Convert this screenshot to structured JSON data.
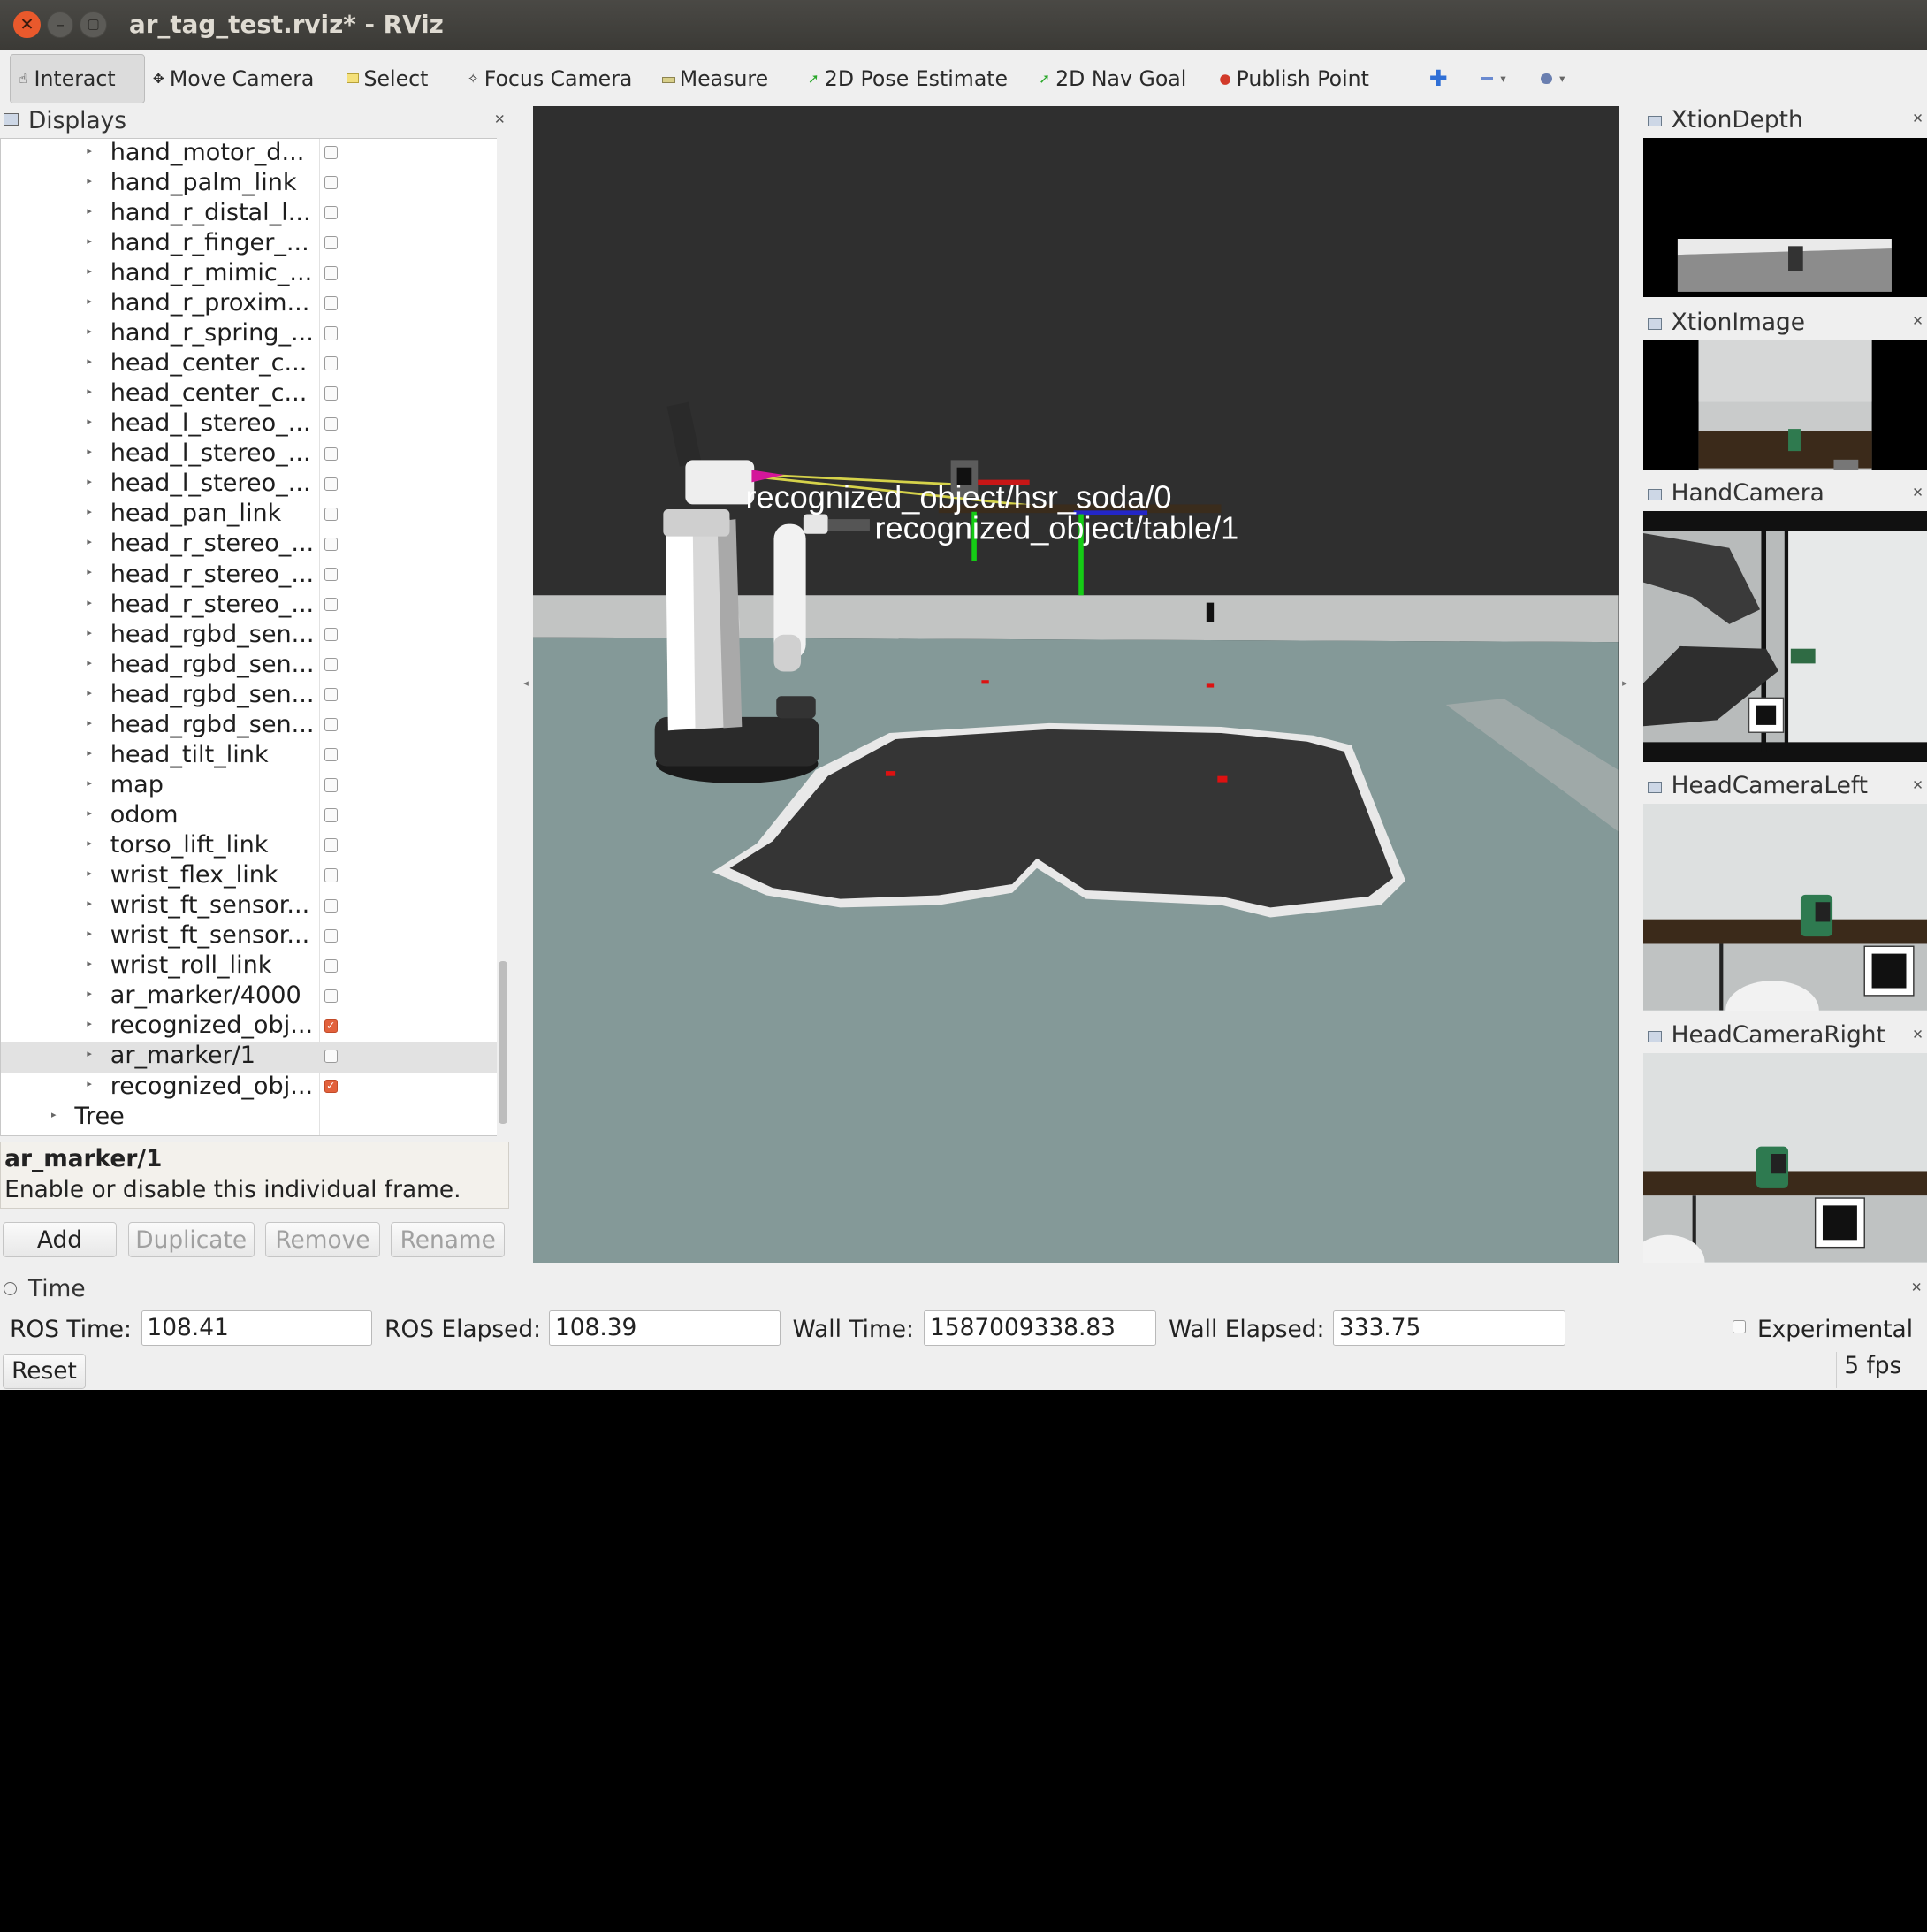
{
  "window": {
    "title": "ar_tag_test.rviz* - RViz"
  },
  "toolbar": {
    "tools": [
      {
        "label": "Interact",
        "active": true
      },
      {
        "label": "Move Camera"
      },
      {
        "label": "Select"
      },
      {
        "label": "Focus Camera"
      },
      {
        "label": "Measure"
      },
      {
        "label": "2D Pose Estimate"
      },
      {
        "label": "2D Nav Goal"
      },
      {
        "label": "Publish Point"
      }
    ]
  },
  "displays": {
    "title": "Displays",
    "frames": [
      {
        "label": "hand_motor_d...",
        "checked": false
      },
      {
        "label": "hand_palm_link",
        "checked": false
      },
      {
        "label": "hand_r_distal_l...",
        "checked": false
      },
      {
        "label": "hand_r_finger_...",
        "checked": false
      },
      {
        "label": "hand_r_mimic_...",
        "checked": false
      },
      {
        "label": "hand_r_proxim...",
        "checked": false
      },
      {
        "label": "hand_r_spring_...",
        "checked": false
      },
      {
        "label": "head_center_c...",
        "checked": false
      },
      {
        "label": "head_center_c...",
        "checked": false
      },
      {
        "label": "head_l_stereo_...",
        "checked": false
      },
      {
        "label": "head_l_stereo_...",
        "checked": false
      },
      {
        "label": "head_l_stereo_...",
        "checked": false
      },
      {
        "label": "head_pan_link",
        "checked": false
      },
      {
        "label": "head_r_stereo_...",
        "checked": false
      },
      {
        "label": "head_r_stereo_...",
        "checked": false
      },
      {
        "label": "head_r_stereo_...",
        "checked": false
      },
      {
        "label": "head_rgbd_sen...",
        "checked": false
      },
      {
        "label": "head_rgbd_sen...",
        "checked": false
      },
      {
        "label": "head_rgbd_sen...",
        "checked": false
      },
      {
        "label": "head_rgbd_sen...",
        "checked": false
      },
      {
        "label": "head_tilt_link",
        "checked": false
      },
      {
        "label": "map",
        "checked": false
      },
      {
        "label": "odom",
        "checked": false
      },
      {
        "label": "torso_lift_link",
        "checked": false
      },
      {
        "label": "wrist_flex_link",
        "checked": false
      },
      {
        "label": "wrist_ft_sensor...",
        "checked": false
      },
      {
        "label": "wrist_ft_sensor...",
        "checked": false
      },
      {
        "label": "wrist_roll_link",
        "checked": false
      },
      {
        "label": "ar_marker/4000",
        "checked": false
      },
      {
        "label": "recognized_obj...",
        "checked": true
      },
      {
        "label": "ar_marker/1",
        "checked": false,
        "selected": true
      },
      {
        "label": "recognized_obj...",
        "checked": true
      }
    ],
    "tree_label": "Tree",
    "description": {
      "title": "ar_marker/1",
      "text": "Enable or disable this individual frame."
    },
    "buttons": {
      "add": "Add",
      "duplicate": "Duplicate",
      "remove": "Remove",
      "rename": "Rename"
    }
  },
  "view3d": {
    "labels": [
      "recognized_object/hsr_soda/0",
      "recognized_object/table/1"
    ]
  },
  "cameras": [
    {
      "title": "XtionDepth"
    },
    {
      "title": "XtionImage"
    },
    {
      "title": "HandCamera"
    },
    {
      "title": "HeadCameraLeft"
    },
    {
      "title": "HeadCameraRight"
    }
  ],
  "time": {
    "title": "Time",
    "ros_time_label": "ROS Time:",
    "ros_time": "108.41",
    "ros_elapsed_label": "ROS Elapsed:",
    "ros_elapsed": "108.39",
    "wall_time_label": "Wall Time:",
    "wall_time": "1587009338.83",
    "wall_elapsed_label": "Wall Elapsed:",
    "wall_elapsed": "333.75",
    "experimental_label": "Experimental",
    "experimental_checked": false
  },
  "status": {
    "reset_label": "Reset",
    "fps": "5 fps"
  }
}
